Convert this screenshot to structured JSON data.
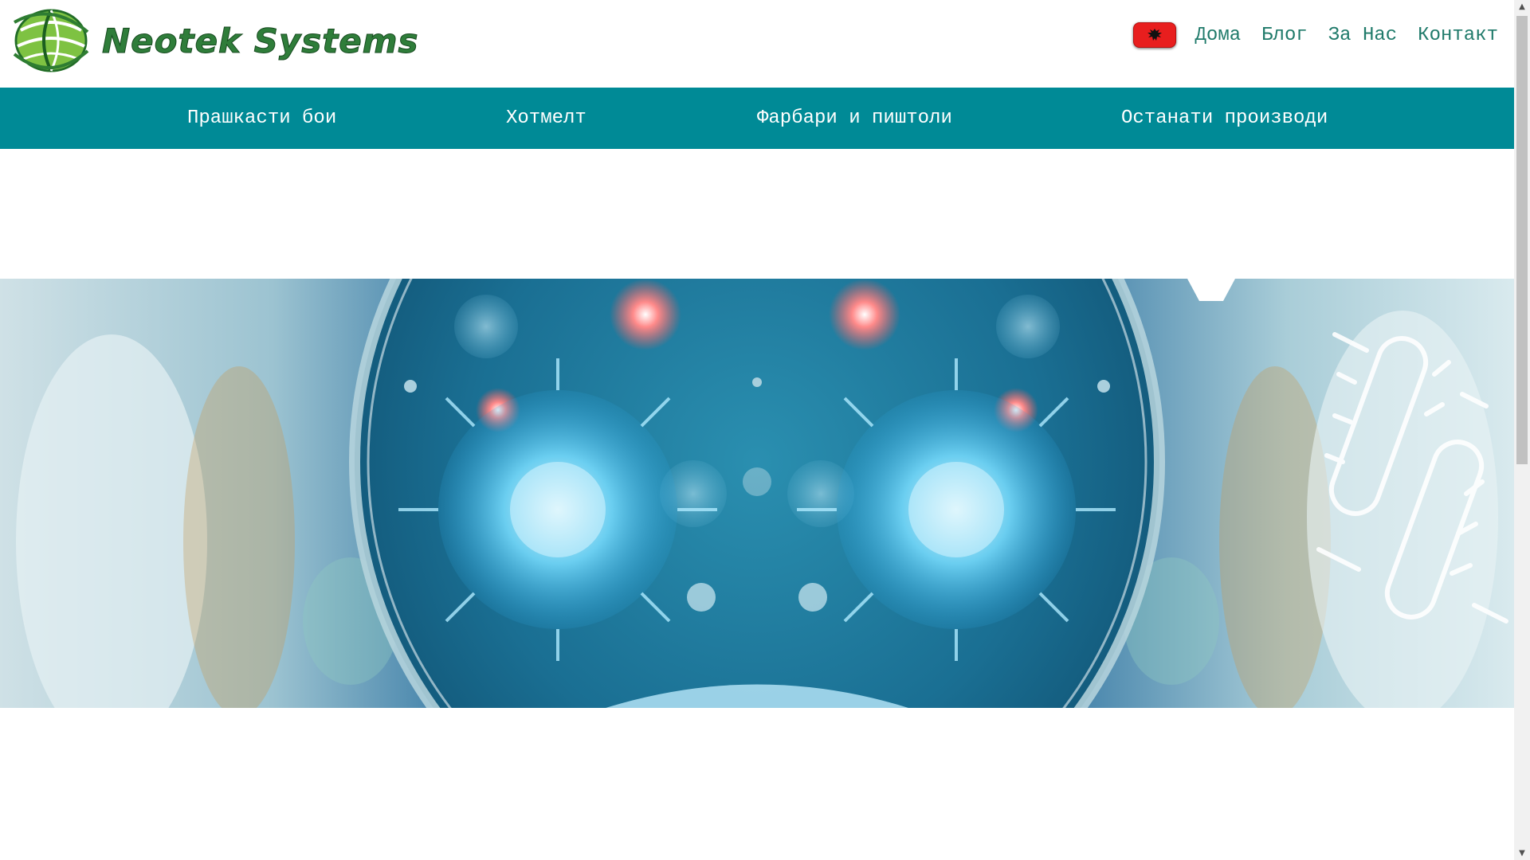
{
  "header": {
    "logo_text": "Neotek Systems",
    "language_flag_icon": "albanian-flag-icon",
    "nav": [
      {
        "label": "Дома"
      },
      {
        "label": "Блог"
      },
      {
        "label": "За Нас"
      },
      {
        "label": "Контакт"
      }
    ]
  },
  "categories": [
    {
      "label": "Прашкасти бои"
    },
    {
      "label": "Хотмелт"
    },
    {
      "label": "Фарбари и пиштоли"
    },
    {
      "label": "Останати производи"
    }
  ],
  "colors": {
    "category_bar": "#008a96",
    "nav_link": "#1f7a6a",
    "logo_green": "#2f7d3a",
    "flag_red": "#e81e1e"
  },
  "icons": {
    "scroll_up": "▲",
    "scroll_down": "▼"
  }
}
